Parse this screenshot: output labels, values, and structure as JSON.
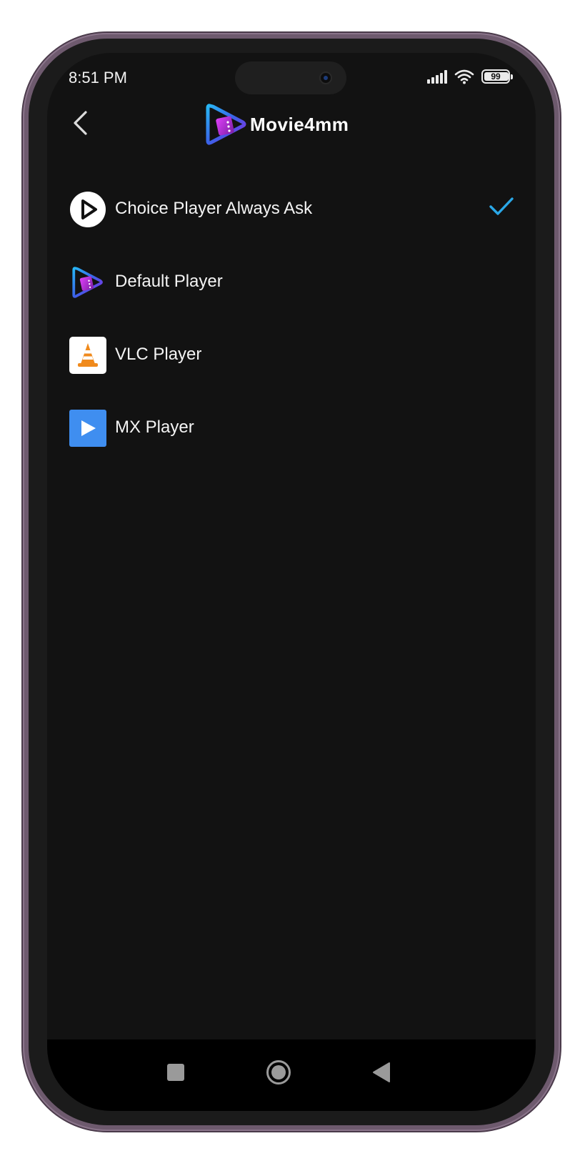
{
  "status_bar": {
    "time": "8:51 PM",
    "battery": "99",
    "icons": [
      "signal-icon",
      "wifi-icon",
      "battery-icon"
    ]
  },
  "header": {
    "back_icon": "chevron-left-icon",
    "app_name": "Movie4mm"
  },
  "players": {
    "items": [
      {
        "label": "Choice Player Always Ask",
        "icon": "play-circle-icon",
        "selected": true
      },
      {
        "label": "Default Player",
        "icon": "movie4mm-logo-icon",
        "selected": false
      },
      {
        "label": "VLC Player",
        "icon": "vlc-cone-icon",
        "selected": false
      },
      {
        "label": "MX Player",
        "icon": "mx-player-icon",
        "selected": false
      }
    ]
  },
  "navbar": {
    "icons": [
      "recent-apps-icon",
      "home-icon",
      "back-triangle-icon"
    ]
  },
  "colors": {
    "background": "#121212",
    "accent_check": "#2aa8e8",
    "mx_blue": "#3f8ef0",
    "vlc_orange": "#f08a1c",
    "frame": "#6e5a6e"
  }
}
